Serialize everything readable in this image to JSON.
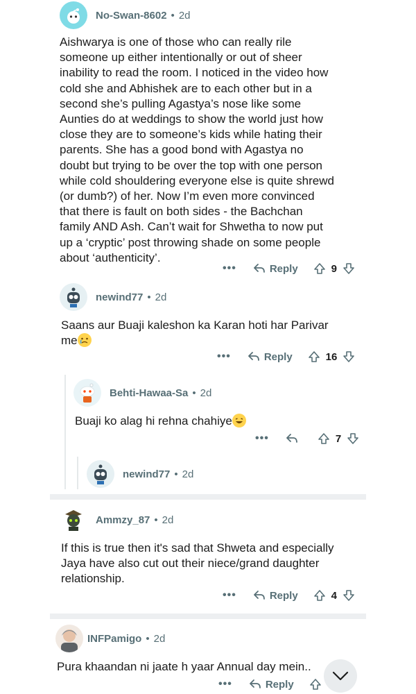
{
  "comments": [
    {
      "user": "No-Swan-8602",
      "time": "2d",
      "text_lines": [
        "Aishwarya is one of those who can really rile",
        "someone up either intentionally or out of sheer",
        "inability to read the room. I noticed in the video how",
        "cold she and Abhishek are to each other but in a",
        "second she’s pulling Agastya’s nose like some",
        "Aunties do at weddings to show the world just how",
        "close they are to someone’s kids while hating their",
        "parents. She has a good bond with Agastya no",
        "doubt but trying to be over the top with one person",
        "while cold shouldering everyone else is quite shrewd",
        "(or dumb?) of her. Now I’m even more convinced",
        "that there is fault on both sides - the Bachchan",
        "family AND Ash. Can’t wait for Shwetha to now put",
        "up a ‘cryptic’ post throwing shade on some people",
        "about ‘authenticity’."
      ],
      "reply_label": "Reply",
      "votes": "9"
    },
    {
      "user": "newind77",
      "time": "2d",
      "text_lines": [
        "Saans aur Buaji kaleshon ka Karan hoti har Parivar",
        "me"
      ],
      "reply_label": "Reply",
      "votes": "16"
    },
    {
      "user": "Behti-Hawaa-Sa",
      "time": "2d",
      "text_lines": [
        "Buaji ko alag hi rehna chahiye"
      ],
      "votes": "7"
    },
    {
      "user": "newind77",
      "time": "2d"
    },
    {
      "user": "Ammzy_87",
      "time": "2d",
      "text_lines": [
        "If this is true then it's sad that Shweta and especially",
        "Jaya have also cut out their niece/grand daughter",
        "relationship."
      ],
      "reply_label": "Reply",
      "votes": "4"
    },
    {
      "user": "INFPamigo",
      "time": "2d",
      "text_lines": [
        "Pura khaandan ni jaate h yaar Annual day mein.."
      ],
      "reply_label": "Reply"
    }
  ],
  "more_glyph": "•••",
  "dot": "•",
  "colors": {
    "meta": "#576f76",
    "text": "#1c1c1c",
    "line": "#e5e9ea",
    "separator": "#edeff1"
  }
}
